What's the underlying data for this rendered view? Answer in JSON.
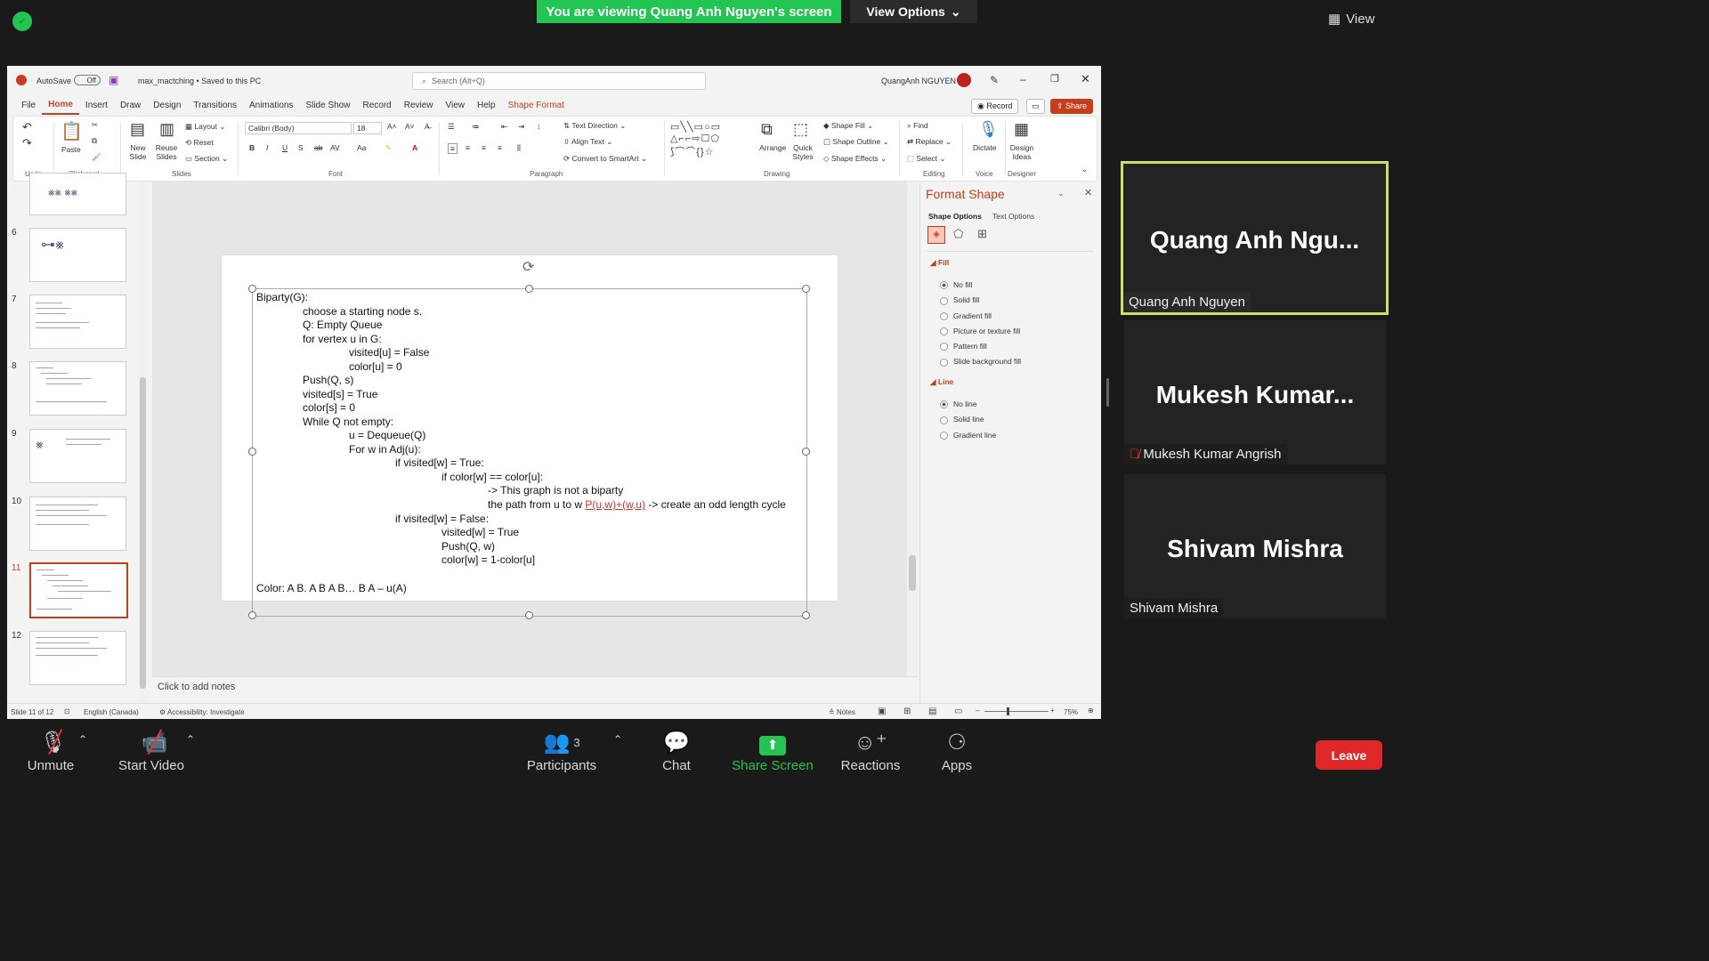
{
  "zoom": {
    "banner": "You are viewing Quang Anh Nguyen's screen",
    "view_options": "View Options",
    "view": "View",
    "participants_count": "3",
    "toolbar": {
      "unmute": "Unmute",
      "start_video": "Start Video",
      "participants": "Participants",
      "chat": "Chat",
      "share_screen": "Share Screen",
      "reactions": "Reactions",
      "apps": "Apps",
      "leave": "Leave"
    },
    "tiles": [
      {
        "big": "Quang Anh Ngu...",
        "label": "Quang Anh Nguyen"
      },
      {
        "big": "Mukesh Kumar...",
        "label": "Mukesh Kumar Angrish"
      },
      {
        "big": "Shivam Mishra",
        "label": "Shivam Mishra"
      }
    ]
  },
  "ppt": {
    "autosave": "AutoSave",
    "autosave_state": "Off",
    "filename": "max_mactching • Saved to this PC",
    "search_placeholder": "Search (Alt+Q)",
    "user": "QuangAnh NGUYEN",
    "record": "Record",
    "share": "Share",
    "menu": [
      "File",
      "Home",
      "Insert",
      "Draw",
      "Design",
      "Transitions",
      "Animations",
      "Slide Show",
      "Record",
      "Review",
      "View",
      "Help",
      "Shape Format"
    ],
    "ribbon": {
      "undo_label": "Undo",
      "paste": "Paste",
      "clipboard": "Clipboard",
      "new_slide": "New Slide",
      "reuse_slides": "Reuse Slides",
      "layout": "Layout",
      "reset": "Reset",
      "section": "Section",
      "slides": "Slides",
      "font_name": "Calibri (Body)",
      "font_size": "18",
      "font": "Font",
      "paragraph": "Paragraph",
      "text_direction": "Text Direction",
      "align_text": "Align Text",
      "convert_smartart": "Convert to SmartArt",
      "drawing": "Drawing",
      "arrange": "Arrange",
      "quick_styles": "Quick Styles",
      "shape_fill": "Shape Fill",
      "shape_outline": "Shape Outline",
      "shape_effects": "Shape Effects",
      "find": "Find",
      "replace": "Replace",
      "select": "Select",
      "editing": "Editing",
      "dictate": "Dictate",
      "voice": "Voice",
      "design_ideas": "Design Ideas",
      "designer": "Designer"
    },
    "thumb_numbers": [
      "6",
      "7",
      "8",
      "9",
      "10",
      "11",
      "12"
    ],
    "slide_lines": [
      "Biparty(G):",
      "choose a starting node s.",
      "Q: Empty Queue",
      "for vertex u in G:",
      "visited[u] = False",
      "color[u] = 0",
      "Push(Q, s)",
      "visited[s] = True",
      "color[s] = 0",
      "While Q not empty:",
      "u = Dequeue(Q)",
      "For w in Adj(u):",
      "if visited[w] = True:",
      "if color[w] == color[u]:",
      "-> This graph is not a biparty",
      "the path from u to w",
      "P(u,w)+(w,u)",
      " -> create an odd length cycle",
      "if visited[w] = False:",
      "visited[w] = True",
      "Push(Q, w)",
      "color[w] = 1-color[u]",
      "Color: A B. A B A B… B A – u(A)"
    ],
    "notes_placeholder": "Click to add notes",
    "format_pane": {
      "title": "Format Shape",
      "tab_shape": "Shape Options",
      "tab_text": "Text Options",
      "fill_header": "Fill",
      "fill_options": [
        "No fill",
        "Solid fill",
        "Gradient fill",
        "Picture or texture fill",
        "Pattern fill",
        "Slide background fill"
      ],
      "line_header": "Line",
      "line_options": [
        "No line",
        "Solid line",
        "Gradient line"
      ]
    },
    "status": {
      "slide": "Slide 11 of 12",
      "language": "English (Canada)",
      "accessibility": "Accessibility: Investigate",
      "notes": "Notes",
      "zoom": "75%"
    }
  },
  "colors": {
    "zoom_green": "#23c552",
    "ppt_accent": "#c43e1c",
    "active_speaker": "#c9e265",
    "leave_red": "#e02828"
  }
}
